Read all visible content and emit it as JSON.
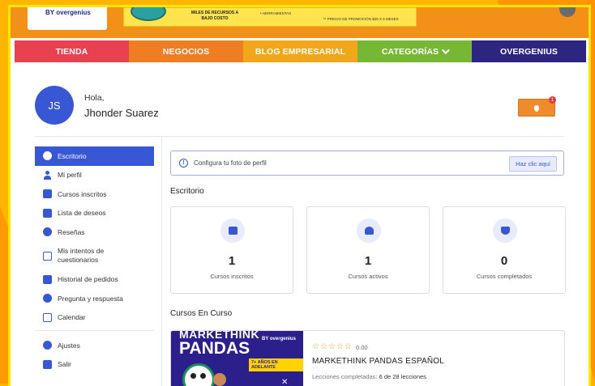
{
  "header": {
    "logo_text": "BY overgenius",
    "banner": {
      "line1": "MILES DE RECURSOS A BAJO COSTO",
      "line2": "• HERRAMIENTAS",
      "line3": "** PRECIO DE PROMOCIÓN $25 X 6 MESES"
    }
  },
  "nav": {
    "items": [
      {
        "label": "TIENDA",
        "color": "#e8414f"
      },
      {
        "label": "NEGOCIOS",
        "color": "#ef7d22"
      },
      {
        "label": "BLOG EMPRESARIAL",
        "color": "#f2a61a"
      },
      {
        "label": "CATEGORÍAS",
        "color": "#76b833"
      },
      {
        "label": "OVERGENIUS",
        "color": "#2d2680"
      }
    ]
  },
  "profile": {
    "initials": "JS",
    "greeting": "Hola,",
    "name": "Jhonder Suarez",
    "notification_count": "1"
  },
  "sidebar": {
    "items": [
      {
        "label": "Escritorio",
        "icon": "dashboard-icon",
        "active": true
      },
      {
        "label": "Mi perfil",
        "icon": "user-icon"
      },
      {
        "label": "Cursos inscritos",
        "icon": "graduation-cap-icon"
      },
      {
        "label": "Lista de deseos",
        "icon": "bookmark-icon"
      },
      {
        "label": "Reseñas",
        "icon": "star-icon"
      },
      {
        "label": "Mis intentos de cuestionarios",
        "icon": "quiz-icon"
      },
      {
        "label": "Historial de pedidos",
        "icon": "cart-icon"
      },
      {
        "label": "Pregunta y respuesta",
        "icon": "question-answer-icon"
      },
      {
        "label": "Calendar",
        "icon": "calendar-icon"
      }
    ],
    "bottom_items": [
      {
        "label": "Ajustes",
        "icon": "gear-icon"
      },
      {
        "label": "Salir",
        "icon": "logout-icon"
      }
    ]
  },
  "alert": {
    "text": "Configura tu foto de perfil",
    "button": "Haz clic aquí"
  },
  "dashboard": {
    "title": "Escritorio",
    "cards": [
      {
        "value": "1",
        "label": "Cursos inscritos",
        "icon": "book-open-icon"
      },
      {
        "value": "1",
        "label": "Cursos activos",
        "icon": "graduation-cap-icon"
      },
      {
        "value": "0",
        "label": "Cursos completados",
        "icon": "trophy-icon"
      }
    ]
  },
  "in_progress": {
    "title": "Cursos En Curso",
    "course": {
      "thumb_line1": "MARKETHINK",
      "thumb_line2": "PANDAS",
      "thumb_brand": "BY overgenius",
      "thumb_tag": "7+ AÑOS EN ADELANTE",
      "stars": "☆☆☆☆☆",
      "rating": "0.00",
      "title": "MARKETHINK PANDAS ESPAÑOL",
      "lessons_label": "Lecciones completadas:",
      "lessons_value": "6 de 28 lecciones"
    }
  }
}
